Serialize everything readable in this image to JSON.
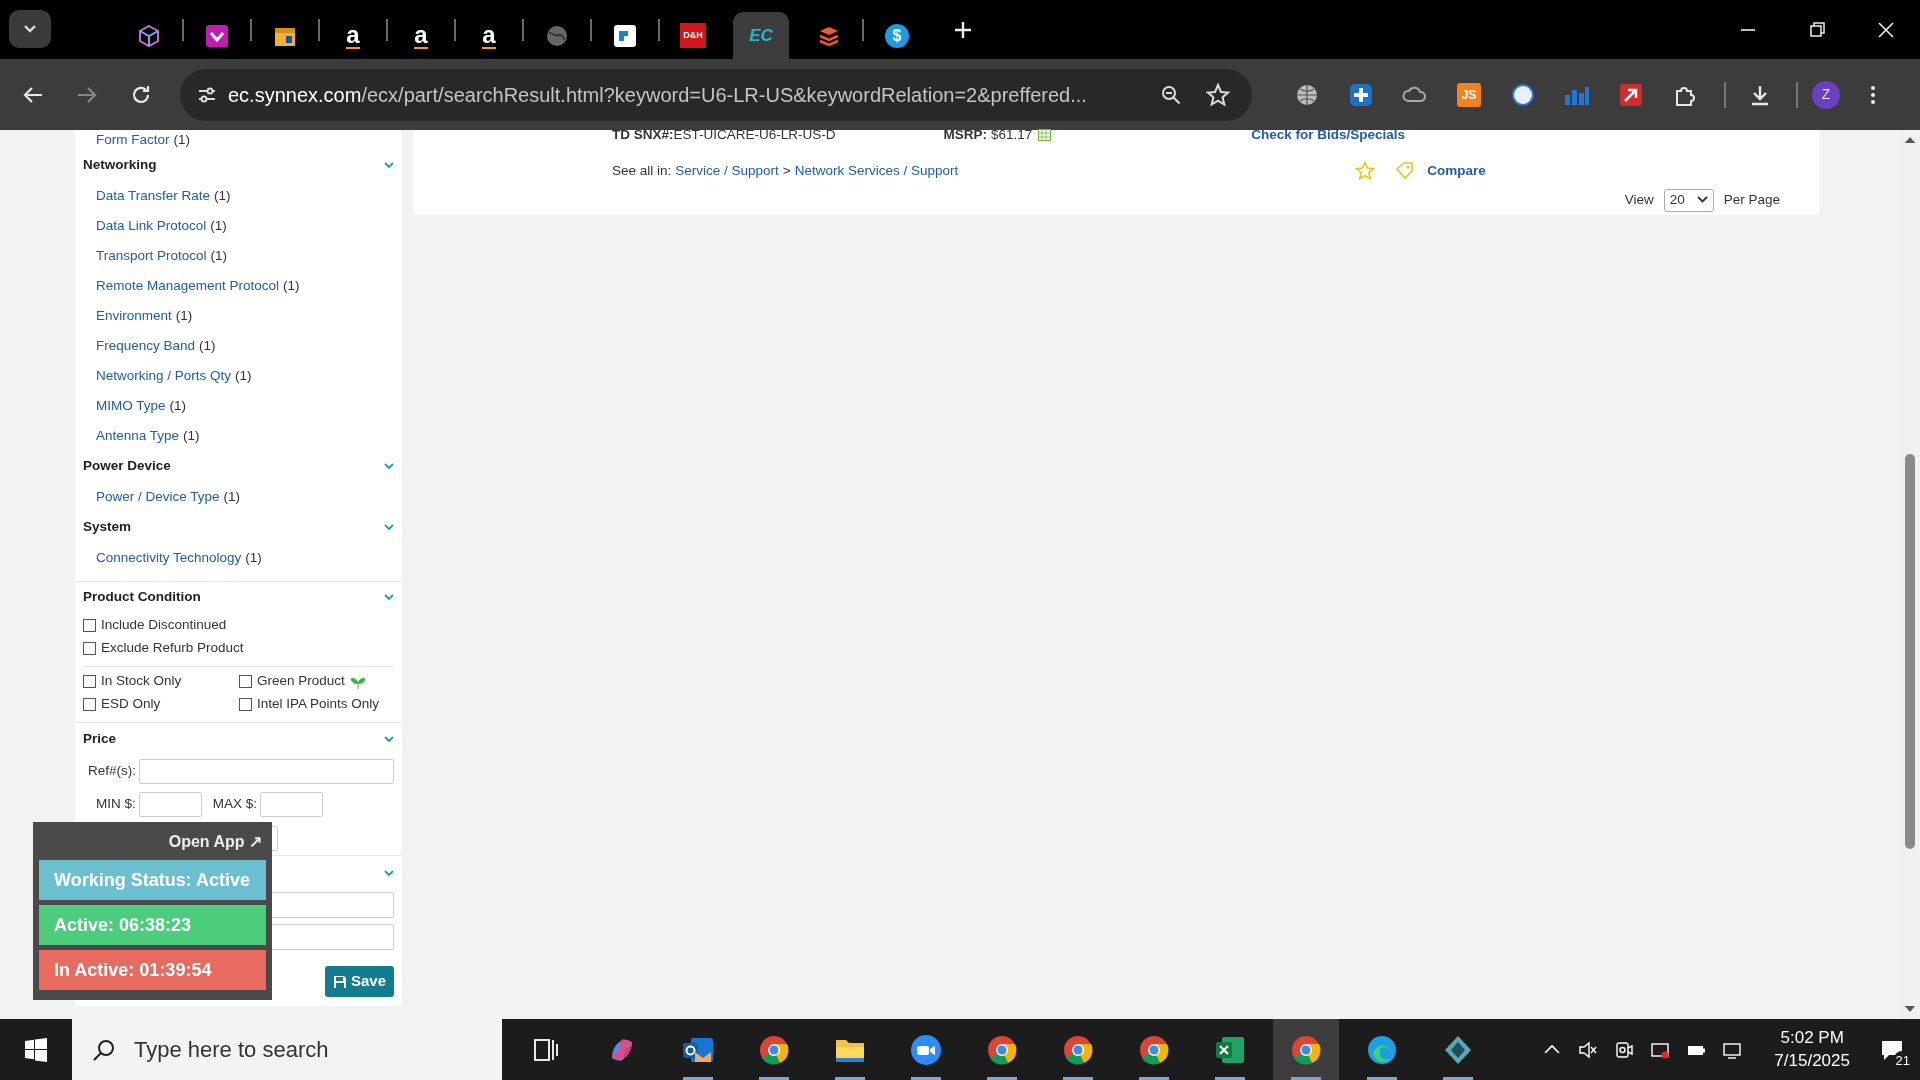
{
  "browser": {
    "tabs": [
      {
        "kind": "cube",
        "selected": false
      },
      {
        "kind": "ribbon",
        "selected": false
      },
      {
        "kind": "box",
        "selected": false
      },
      {
        "kind": "amazon",
        "label": "a",
        "selected": false
      },
      {
        "kind": "amazon",
        "label": "a",
        "selected": false
      },
      {
        "kind": "amazon",
        "label": "a",
        "selected": false
      },
      {
        "kind": "globe",
        "selected": false
      },
      {
        "kind": "square",
        "selected": false
      },
      {
        "kind": "badge",
        "label": "D&H",
        "selected": false
      },
      {
        "kind": "badge",
        "label": "EC",
        "selected": true
      },
      {
        "kind": "layers",
        "selected": false
      },
      {
        "kind": "coin",
        "label": "$",
        "selected": false
      }
    ],
    "address": {
      "domain": "ec.synnex.com",
      "path": "/ecx/part/searchResult.html?keyword=U6-LR-US&keywordRelation=2&preffered..."
    },
    "extensions": [
      {
        "kind": "globe"
      },
      {
        "kind": "plus"
      },
      {
        "kind": "cloud"
      },
      {
        "kind": "js",
        "label": "JS"
      },
      {
        "kind": "circle"
      },
      {
        "kind": "chart"
      },
      {
        "kind": "arrow"
      },
      {
        "kind": "puzzle"
      }
    ],
    "profile": "Z"
  },
  "result": {
    "sku_label": "TD SNX#:",
    "sku": "EST-UICARE-U6-LR-US-D",
    "msrp_label": "MSRP:",
    "msrp": "$61.17",
    "bids_link": "Check for Bids/Specials",
    "see_all_label": "See all in:",
    "category_path": [
      "Service / Support",
      "Network Services / Support"
    ],
    "separator": ">",
    "compare": "Compare"
  },
  "paging": {
    "label": "View",
    "per_page": "20",
    "suffix": "Per Page"
  },
  "sidebar": {
    "top_item": {
      "label": "Form Factor",
      "count": "(1)"
    },
    "groups": [
      {
        "title": "Networking",
        "items": [
          {
            "label": "Data Transfer Rate",
            "count": "(1)"
          },
          {
            "label": "Data Link Protocol",
            "count": "(1)"
          },
          {
            "label": "Transport Protocol",
            "count": "(1)"
          },
          {
            "label": "Remote Management Protocol",
            "count": "(1)"
          },
          {
            "label": "Environment",
            "count": "(1)"
          },
          {
            "label": "Frequency Band",
            "count": "(1)"
          },
          {
            "label": "Networking / Ports Qty",
            "count": "(1)"
          },
          {
            "label": "MIMO Type",
            "count": "(1)"
          },
          {
            "label": "Antenna Type",
            "count": "(1)"
          }
        ]
      },
      {
        "title": "Power Device",
        "items": [
          {
            "label": "Power / Device Type",
            "count": "(1)"
          }
        ]
      },
      {
        "title": "System",
        "items": [
          {
            "label": "Connectivity Technology",
            "count": "(1)"
          }
        ]
      }
    ],
    "condition": {
      "title": "Product Condition",
      "options": [
        {
          "label": "Include Discontinued",
          "checked": false
        },
        {
          "label": "Exclude Refurb Product",
          "checked": false
        }
      ],
      "filters": [
        {
          "label": "In Stock Only",
          "checked": false,
          "kind": "plain"
        },
        {
          "label": "Green Product",
          "checked": false,
          "kind": "eco"
        },
        {
          "label": "ESD Only",
          "checked": false,
          "kind": "plain"
        },
        {
          "label": "Intel IPA Points Only",
          "checked": false,
          "kind": "plain"
        }
      ]
    },
    "price": {
      "title": "Price",
      "ref_label": "Ref#(s):",
      "min_label": "MIN $:",
      "max_label": "MAX $:"
    },
    "save": "Save"
  },
  "tracker": {
    "open_app": "Open App ↗",
    "statuses": [
      {
        "text": "Working Status: Active",
        "color": "#6cbfcf"
      },
      {
        "text": "Active: 06:38:23",
        "color": "#4ccd7d"
      },
      {
        "text": "In Active: 01:39:54",
        "color": "#e96a5f"
      }
    ]
  },
  "taskbar": {
    "search_placeholder": "Type here to search",
    "apps": [
      {
        "kind": "taskview",
        "running": false,
        "selected": false
      },
      {
        "kind": "copilot",
        "running": false,
        "selected": false
      },
      {
        "kind": "outlook",
        "running": true,
        "selected": false
      },
      {
        "kind": "chrome",
        "running": true,
        "selected": false
      },
      {
        "kind": "folder",
        "running": true,
        "selected": false
      },
      {
        "kind": "zoom",
        "running": true,
        "selected": false
      },
      {
        "kind": "chrome",
        "running": true,
        "selected": false
      },
      {
        "kind": "chrome",
        "running": true,
        "selected": false
      },
      {
        "kind": "chrome",
        "running": true,
        "selected": false
      },
      {
        "kind": "excel",
        "running": true,
        "selected": false
      },
      {
        "kind": "chrome",
        "running": true,
        "selected": true
      },
      {
        "kind": "edge",
        "running": true,
        "selected": false
      },
      {
        "kind": "diamond",
        "running": true,
        "selected": false
      }
    ],
    "time": "5:02 PM",
    "date": "7/15/2025",
    "notifications": "21"
  }
}
